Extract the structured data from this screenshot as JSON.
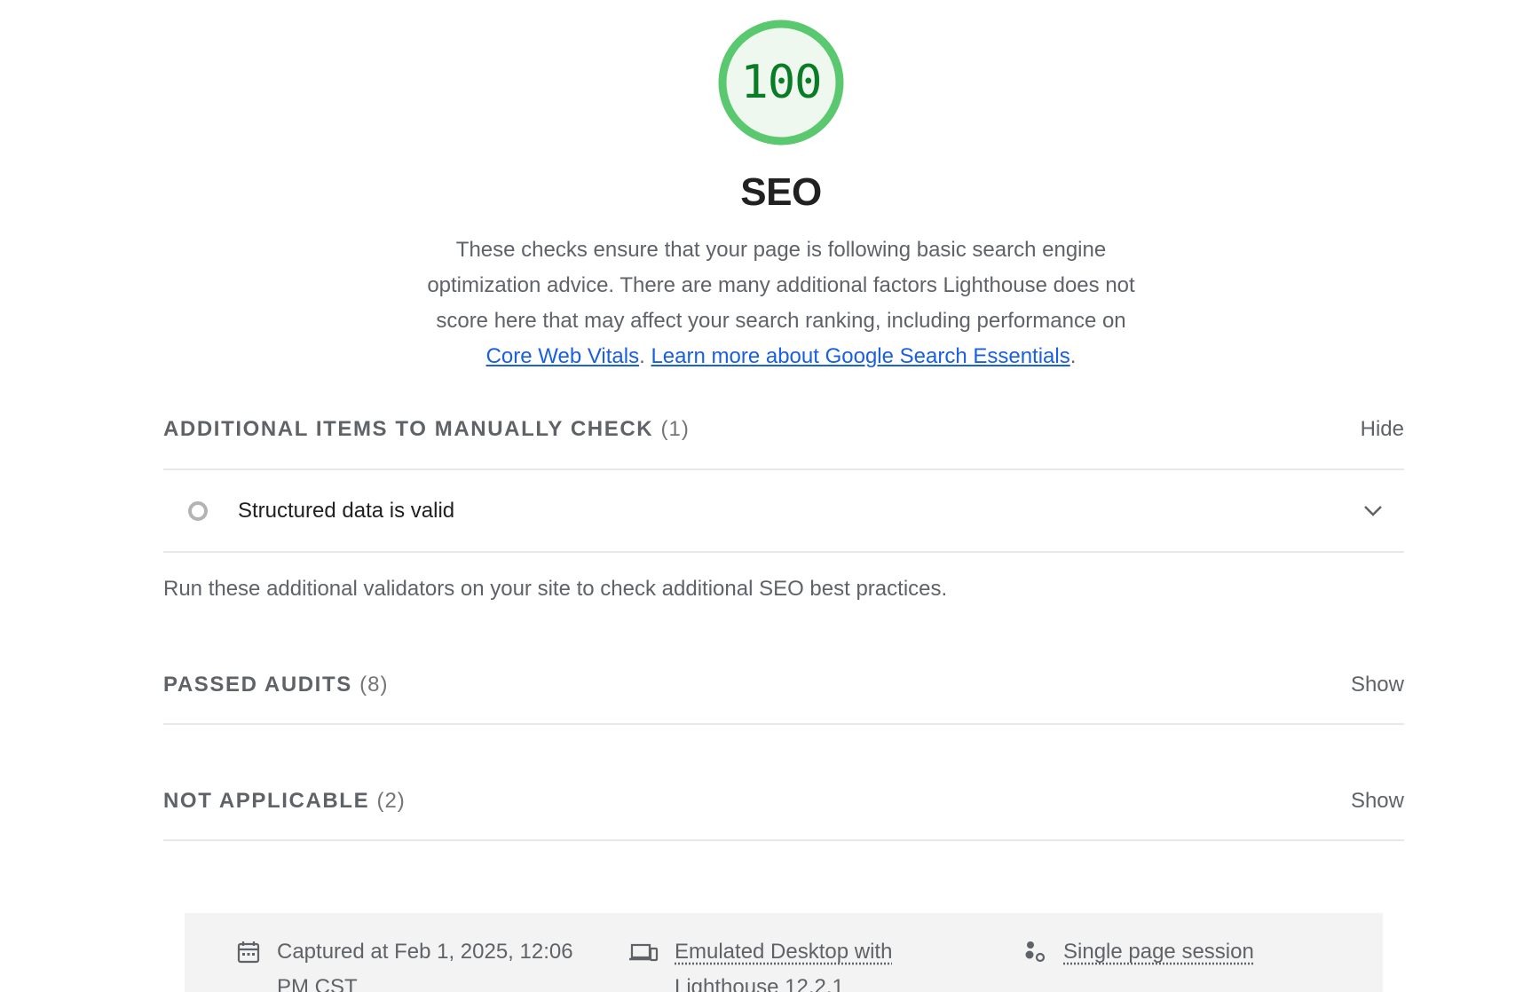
{
  "score": {
    "value": "100",
    "fraction": 1.0,
    "ring_color": "#5ac86e",
    "fill_color": "#eef8ef",
    "text_color": "#0a7b26"
  },
  "category": {
    "title": "SEO",
    "description": "These checks ensure that your page is following basic search engine optimization advice. There are many additional factors Lighthouse does not score here that may affect your search ranking, including performance on",
    "link_core_web_vitals": "Core Web Vitals",
    "separator": ".",
    "link_learn_more": "Learn more about Google Search Essentials",
    "trailing": "."
  },
  "groups": {
    "manual": {
      "title": "ADDITIONAL ITEMS TO MANUALLY CHECK",
      "count": "(1)",
      "toggle": "Hide",
      "audit_title": "Structured data is valid",
      "description": "Run these additional validators on your site to check additional SEO best practices."
    },
    "passed": {
      "title": "PASSED AUDITS",
      "count": "(8)",
      "toggle": "Show"
    },
    "not_applicable": {
      "title": "NOT APPLICABLE",
      "count": "(2)",
      "toggle": "Show"
    }
  },
  "footer": {
    "captured_line1": "Captured at Feb 1, 2025, 12:06",
    "captured_line2": "PM CST",
    "emulated_line1": "Emulated Desktop with",
    "emulated_line2": "Lighthouse 12.2.1",
    "session": "Single page session",
    "icons": [
      "calendar-icon",
      "devices-icon",
      "session-icon"
    ]
  },
  "colors": {
    "link": "#1a5fe0",
    "muted_text": "#5f6368",
    "divider": "#e8e8e8",
    "footer_bg": "#f3f3f3"
  }
}
